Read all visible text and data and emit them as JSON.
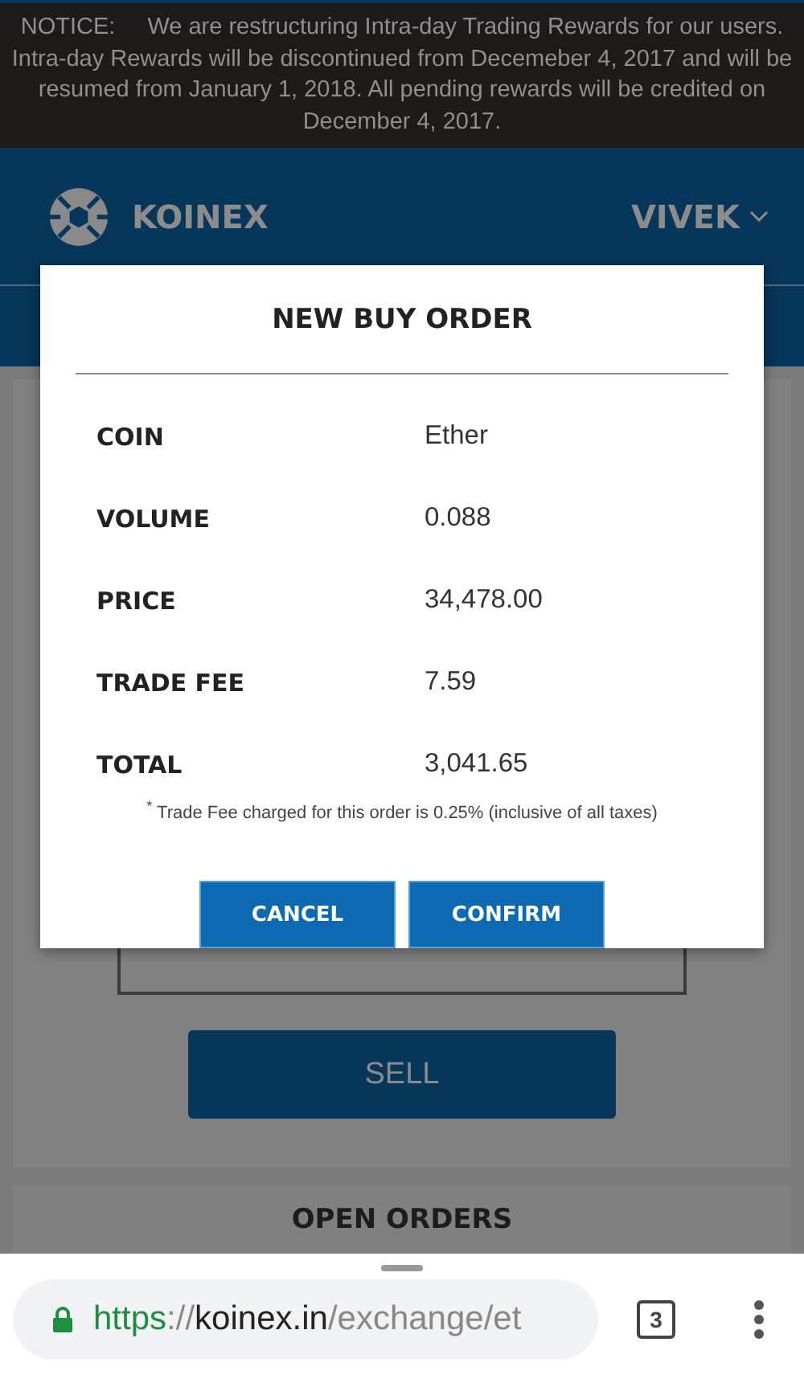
{
  "notice": {
    "label": "NOTICE:",
    "text": "We are restructuring Intra-day Trading Rewards for our users. Intra-day Rewards will be discontinued from Decemeber 4, 2017 and will be resumed from January 1, 2018. All pending rewards will be credited on December 4, 2017."
  },
  "header": {
    "brand": "KOINEX",
    "user": "VIVEK"
  },
  "modal": {
    "title": "NEW BUY ORDER",
    "rows": [
      {
        "label": "COIN",
        "value": "Ether"
      },
      {
        "label": "VOLUME",
        "value": "0.088"
      },
      {
        "label": "PRICE",
        "value": "34,478.00"
      },
      {
        "label": "TRADE FEE",
        "value": "7.59"
      },
      {
        "label": "TOTAL",
        "value": "3,041.65"
      }
    ],
    "footnote": "$^{*}$ Trade Fee charged for this order is 0.25% (inclusive of all taxes)",
    "buttons": [
      "CANCEL",
      "CONFIRM"
    ]
  },
  "page": {
    "sell_button": "SELL",
    "section_title": "OPEN ORDERS"
  },
  "browser": {
    "url": {
      "scheme": "https",
      "separator": "://",
      "host": "koinex.in",
      "path": "/exchange/et"
    },
    "tab_count": "3"
  }
}
